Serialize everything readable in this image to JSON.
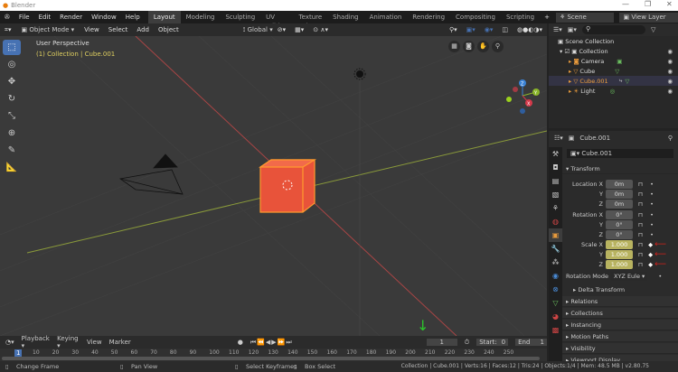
{
  "window": {
    "title": "Blender"
  },
  "menu": [
    "File",
    "Edit",
    "Render",
    "Window",
    "Help"
  ],
  "workspaces": [
    "Layout",
    "Modeling",
    "Sculpting",
    "UV Editing",
    "Texture Paint",
    "Shading",
    "Animation",
    "Rendering",
    "Compositing",
    "Scripting"
  ],
  "scene": "Scene",
  "view_layer": "View Layer",
  "viewport_header": {
    "mode": "Object Mode",
    "menus": [
      "View",
      "Select",
      "Add",
      "Object"
    ],
    "transform_orientation": "Global"
  },
  "viewport": {
    "perspective": "User Perspective",
    "context": "(1) Collection | Cube.001",
    "axes": {
      "x": "X",
      "y": "Y",
      "z": "Z"
    }
  },
  "outliner": {
    "root": "Scene Collection",
    "collection": "Collection",
    "items": [
      "Camera",
      "Cube",
      "Cube.001",
      "Light"
    ]
  },
  "properties": {
    "object_name": "Cube.001",
    "datablock": "Cube.001",
    "section": "Transform",
    "location": {
      "label": "Location X",
      "x": "0m",
      "y": "0m",
      "z": "0m"
    },
    "rotation": {
      "label": "Rotation X",
      "x": "0°",
      "y": "0°",
      "z": "0°"
    },
    "scale": {
      "label": "Scale X",
      "x": "1.000",
      "y": "1.000",
      "z": "1.000"
    },
    "axis_y": "Y",
    "axis_z": "Z",
    "rotation_mode_label": "Rotation Mode",
    "rotation_mode": "XYZ Eule",
    "subpanels": [
      "Delta Transform"
    ],
    "panels": [
      "Relations",
      "Collections",
      "Instancing",
      "Motion Paths",
      "Visibility",
      "Viewport Display"
    ]
  },
  "timeline": {
    "menus": [
      "Playback",
      "Keying",
      "View",
      "Marker"
    ],
    "current_frame": "1",
    "start_label": "Start:",
    "start": "0",
    "end_label": "End",
    "end": "1",
    "ticks": [
      "10",
      "20",
      "30",
      "40",
      "50",
      "60",
      "70",
      "80",
      "90",
      "100",
      "110",
      "120",
      "130",
      "140",
      "150",
      "160",
      "170",
      "180",
      "190",
      "200",
      "210",
      "220",
      "230",
      "240",
      "250"
    ],
    "playhead": "1"
  },
  "statusbar": {
    "left": [
      "Change Frame",
      "Pan View",
      "Select Keyframes",
      "Box Select"
    ],
    "info": "Collection | Cube.001 | Verts:16 | Faces:12 | Tris:24 | Objects:1/4 | Mem: 48.5 MB | v2.80.75"
  },
  "colors": {
    "accent": "#4772b3",
    "selected_orange": "#ff8c1a",
    "keyframe_field": "#b8b360",
    "annotation": "#d0201a"
  }
}
